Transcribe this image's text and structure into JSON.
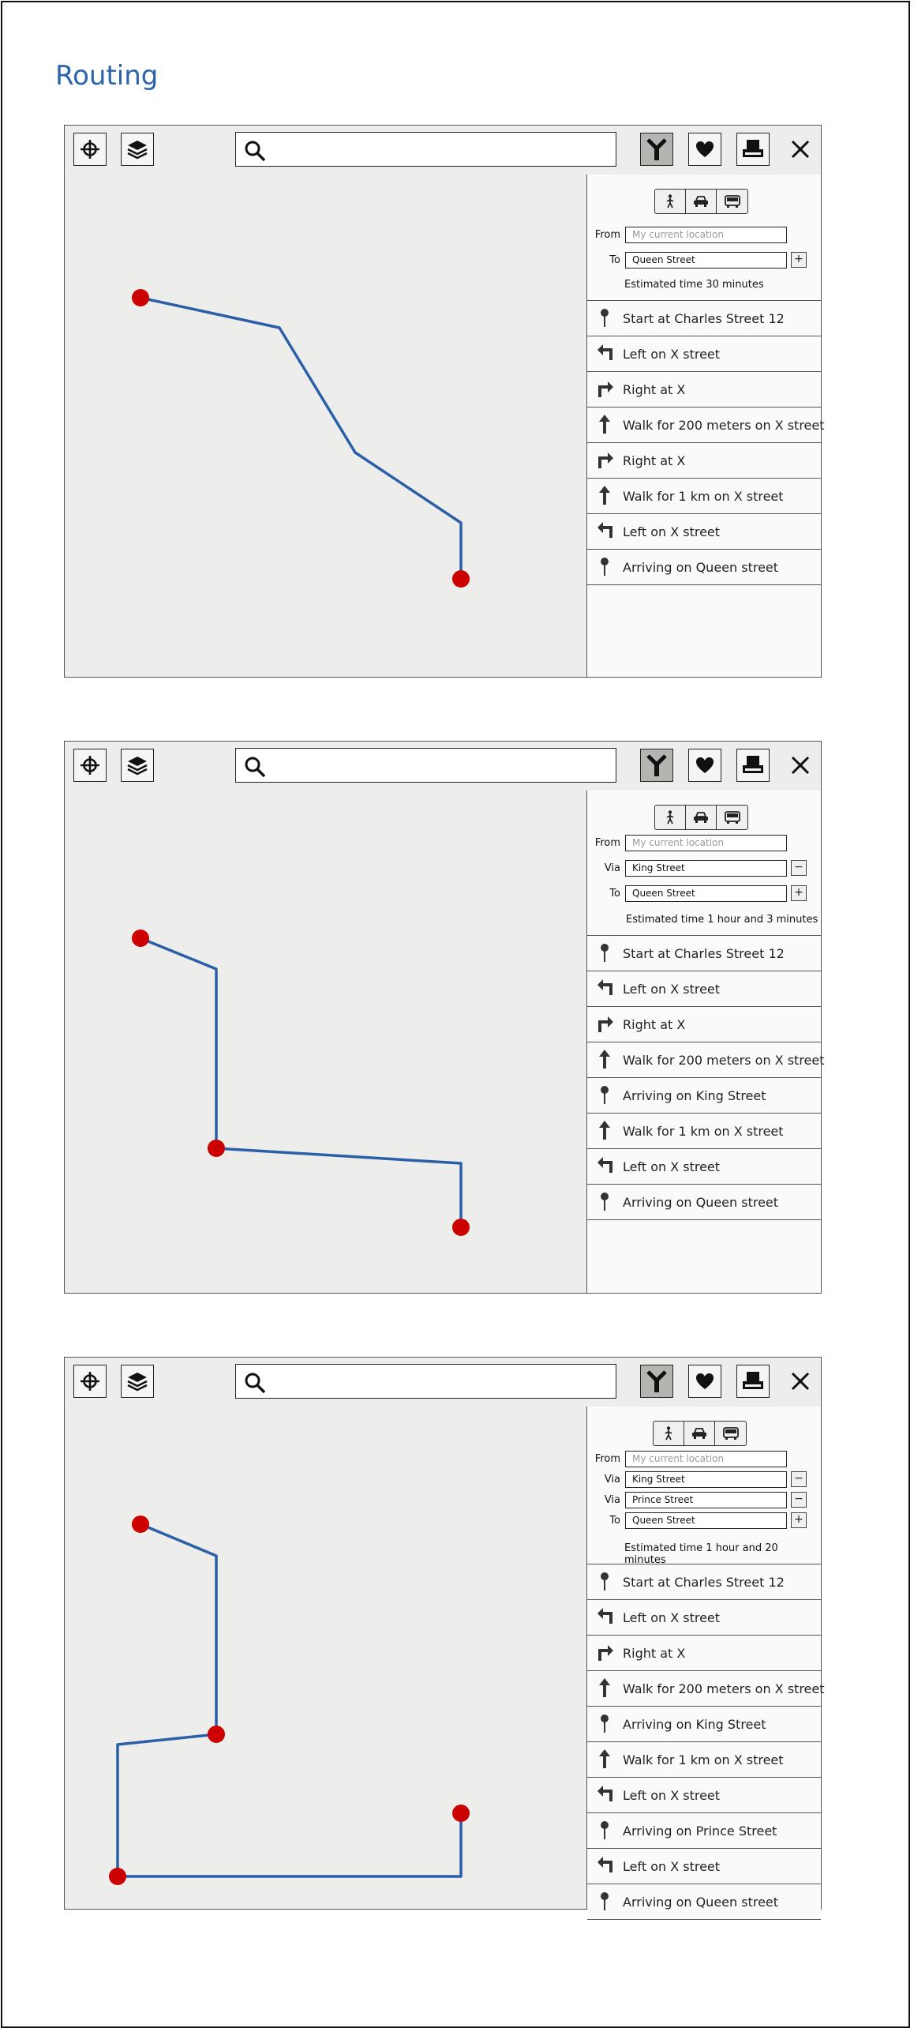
{
  "page": {
    "title": "Routing"
  },
  "colors": {
    "title": "#2b63ad",
    "route": "#2b5fa7",
    "marker": "#cc0000",
    "map_bg": "#ededeb"
  },
  "toolbar": {
    "icons": [
      "crosshair-icon",
      "layers-icon",
      "search-icon",
      "route-icon",
      "heart-icon",
      "printer-icon",
      "close-icon"
    ],
    "search_placeholder": "",
    "active_button": "route-icon"
  },
  "mockups": [
    {
      "modes": [
        "walk-icon",
        "car-icon",
        "bus-icon"
      ],
      "fields": [
        {
          "label": "From",
          "value": "My current location",
          "placeholder": true,
          "action": ""
        },
        {
          "label": "To",
          "value": "Queen Street",
          "placeholder": false,
          "action": "+"
        }
      ],
      "estimate": "Estimated time 30 minutes",
      "steps": [
        {
          "icon": "pin-icon",
          "text": "Start at Charles Street 12"
        },
        {
          "icon": "turn-left-icon",
          "text": "Left on X street"
        },
        {
          "icon": "turn-right-icon",
          "text": "Right at X"
        },
        {
          "icon": "arrow-up-icon",
          "text": "Walk for 200 meters on X street"
        },
        {
          "icon": "turn-right-icon",
          "text": "Right at X"
        },
        {
          "icon": "arrow-up-icon",
          "text": "Walk for 1 km on X street"
        },
        {
          "icon": "turn-left-icon",
          "text": "Left on X street"
        },
        {
          "icon": "pin-icon",
          "text": "Arriving on Queen street"
        }
      ]
    },
    {
      "modes": [
        "walk-icon",
        "car-icon",
        "bus-icon"
      ],
      "fields": [
        {
          "label": "From",
          "value": "My current location",
          "placeholder": true,
          "action": ""
        },
        {
          "label": "Via",
          "value": "King Street",
          "placeholder": false,
          "action": "−"
        },
        {
          "label": "To",
          "value": "Queen Street",
          "placeholder": false,
          "action": "+"
        }
      ],
      "estimate": "Estimated time 1 hour and 3 minutes",
      "steps": [
        {
          "icon": "pin-icon",
          "text": "Start at Charles Street 12"
        },
        {
          "icon": "turn-left-icon",
          "text": "Left on X street"
        },
        {
          "icon": "turn-right-icon",
          "text": "Right at X"
        },
        {
          "icon": "arrow-up-icon",
          "text": "Walk for 200 meters on X street"
        },
        {
          "icon": "pin-icon",
          "text": "Arriving on King Street"
        },
        {
          "icon": "arrow-up-icon",
          "text": "Walk for 1 km on X street"
        },
        {
          "icon": "turn-left-icon",
          "text": "Left on X street"
        },
        {
          "icon": "pin-icon",
          "text": "Arriving on Queen street"
        }
      ]
    },
    {
      "modes": [
        "walk-icon",
        "car-icon",
        "bus-icon"
      ],
      "fields": [
        {
          "label": "From",
          "value": "My current location",
          "placeholder": true,
          "action": ""
        },
        {
          "label": "Via",
          "value": "King Street",
          "placeholder": false,
          "action": "−"
        },
        {
          "label": "Via",
          "value": "Prince Street",
          "placeholder": false,
          "action": "−"
        },
        {
          "label": "To",
          "value": "Queen Street",
          "placeholder": false,
          "action": "+"
        }
      ],
      "estimate": "Estimated time 1 hour and 20 minutes",
      "steps": [
        {
          "icon": "pin-icon",
          "text": "Start at Charles Street 12"
        },
        {
          "icon": "turn-left-icon",
          "text": "Left on X street"
        },
        {
          "icon": "turn-right-icon",
          "text": "Right at X"
        },
        {
          "icon": "arrow-up-icon",
          "text": "Walk for 200 meters on X street"
        },
        {
          "icon": "pin-icon",
          "text": "Arriving on King Street"
        },
        {
          "icon": "arrow-up-icon",
          "text": "Walk for 1 km on X street"
        },
        {
          "icon": "turn-left-icon",
          "text": "Left on X street"
        },
        {
          "icon": "pin-icon",
          "text": "Arriving on Prince Street"
        },
        {
          "icon": "turn-left-icon",
          "text": "Left on X street"
        },
        {
          "icon": "pin-icon",
          "text": "Arriving on Queen street"
        }
      ]
    }
  ]
}
